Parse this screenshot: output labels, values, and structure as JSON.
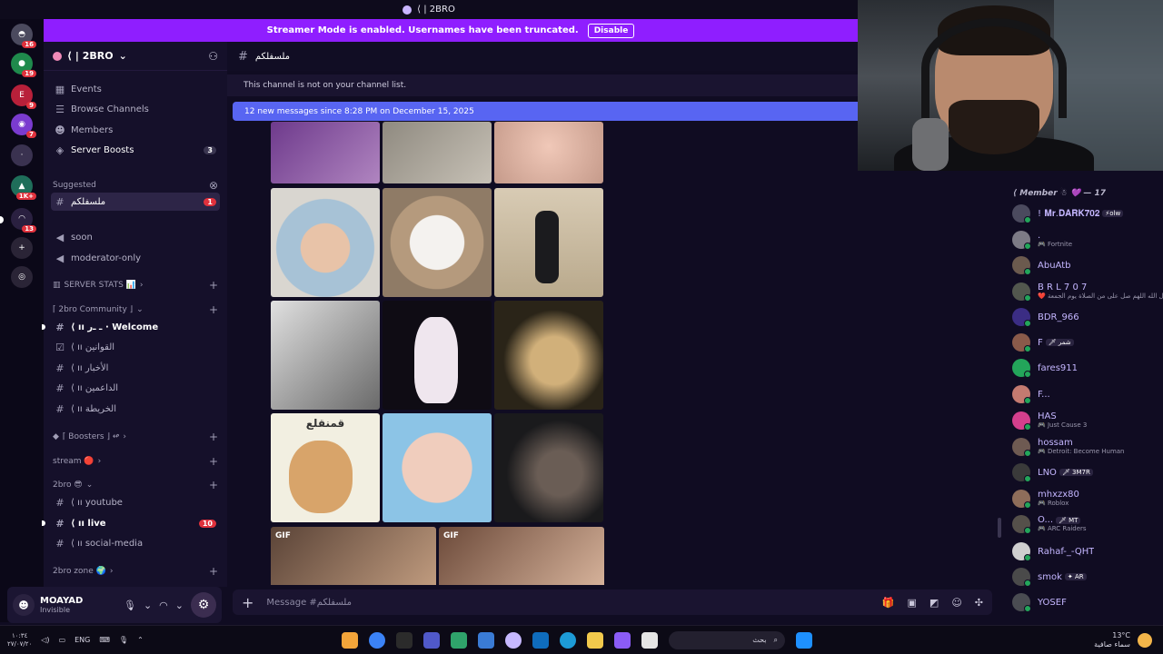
{
  "titlebar": {
    "title": "⟨ | 2BRO"
  },
  "banner": {
    "text": "Streamer Mode is enabled. Usernames have been truncated.",
    "button": "Disable"
  },
  "servers": [
    {
      "icon": "discord-icon",
      "badge": "16",
      "color": "#4b4a5e"
    },
    {
      "icon": "server-icon",
      "badge": "19",
      "color": "#1f8a4c"
    },
    {
      "icon": "server-icon",
      "badge": "9",
      "color": "#b8203a"
    },
    {
      "icon": "server-icon",
      "badge": "7",
      "color": "#7a3bcf"
    },
    {
      "icon": "server-icon",
      "badge": "",
      "color": "#3a3250"
    },
    {
      "icon": "server-icon",
      "badge": "1K+",
      "color": "#1f6e5a"
    },
    {
      "icon": "server-icon",
      "badge": "13",
      "color": "#2a2040"
    },
    {
      "icon": "add-server-icon",
      "badge": "",
      "color": "#2a2436"
    },
    {
      "icon": "explore-icon",
      "badge": "",
      "color": "#2a2436"
    }
  ],
  "guild": {
    "name": "⟨ | 2BRO"
  },
  "sidebar": {
    "top_items": [
      {
        "label": "Events",
        "icon": "calendar-icon"
      },
      {
        "label": "Browse Channels",
        "icon": "browse-icon"
      },
      {
        "label": "Members",
        "icon": "members-icon"
      },
      {
        "label": "Server Boosts",
        "icon": "boost-icon",
        "count": "3"
      }
    ],
    "suggested_label": "Suggested",
    "suggested_channel": {
      "label": "ملسفلكم",
      "count": "1"
    },
    "channels_a": [
      {
        "label": "soon",
        "icon": "megaphone-icon"
      },
      {
        "label": "moderator-only",
        "icon": "megaphone-icon"
      }
    ],
    "cat_server_stats": "SERVER STATS 📊",
    "cat_community": "⌈ 2bro Community ⌋",
    "community": [
      {
        "label": "⟨ ıı ـ ـﺭ · Welcome",
        "unread": true
      },
      {
        "label": "⟨ ıı القوانين",
        "unread": false
      },
      {
        "label": "⟨ ıı الأخبار",
        "unread": false
      },
      {
        "label": "⟨ ıı الداعمين",
        "unread": false
      },
      {
        "label": "⟨ ıı الخريطة",
        "unread": false
      }
    ],
    "cat_boosters": "⌈ Boosters ⌋ ↫",
    "cat_stream": "stream 🔴",
    "cat_2bro": "2bro 😎",
    "bro_channels": [
      {
        "label": "⟨ ıı youtube",
        "unread": false,
        "count": ""
      },
      {
        "label": "⟨ ıı live",
        "unread": true,
        "count": "10"
      },
      {
        "label": "⟨ ıı social-media",
        "unread": false,
        "count": ""
      }
    ],
    "cat_zone": "2bro zone 🌍"
  },
  "user": {
    "name": "MOAYAD",
    "status": "Invisible"
  },
  "chat": {
    "channel_name": "ملسفلكم",
    "notice": "This channel is not on your channel list.",
    "new_messages": "12 new messages since 8:28 PM on December 15, 2025",
    "gif_labels": [
      "GIF",
      "GIF"
    ],
    "composer_placeholder": "Message #ملسفلكم",
    "sticker_caption": "قمنقلع"
  },
  "members": {
    "header": "⟨ Member ☃ 💜 — 17",
    "list": [
      {
        "name": "! 𝐌𝐫.𝐃𝐀𝐑𝐊𝟕𝟎𝟐",
        "sub": "",
        "tag": "⚡olw",
        "color": "#4b4a5e"
      },
      {
        "name": ".",
        "sub": "🎮 Fortnite",
        "tag": "",
        "color": "#7d7b86"
      },
      {
        "name": "AbuAtb",
        "sub": "",
        "tag": "",
        "color": "#6b5a4e"
      },
      {
        "name": "B R L 7 0 7",
        "sub": "❤️ رسول الله اللهم صل على من الصلاة يوم الجمعة",
        "tag": "",
        "color": "#52574e"
      },
      {
        "name": "BDR_966",
        "sub": "",
        "tag": "",
        "color": "#3b2d84"
      },
      {
        "name": "F",
        "sub": "",
        "tag": "🗡 شمر",
        "color": "#8a5a4a"
      },
      {
        "name": "fares911",
        "sub": "",
        "tag": "",
        "color": "#23a55a"
      },
      {
        "name": "F...",
        "sub": "",
        "tag": "",
        "color": "#c47a70"
      },
      {
        "name": "HAS",
        "sub": "🎮 Just Cause 3",
        "tag": "",
        "color": "#d43f8d"
      },
      {
        "name": "hossam",
        "sub": "🎮 Detroit: Become Human",
        "tag": "",
        "color": "#6e5a52"
      },
      {
        "name": "LNO",
        "sub": "",
        "tag": "🗡 3M7R",
        "color": "#3a3a3a"
      },
      {
        "name": "mhxzx80",
        "sub": "🎮 Roblox",
        "tag": "",
        "color": "#8e6d5a"
      },
      {
        "name": "O...",
        "sub": "🎮 ARC Raiders",
        "tag": "🗡 MT",
        "color": "#55504a"
      },
      {
        "name": "Rahaf-_-QHT",
        "sub": "",
        "tag": "",
        "color": "#cfcfcf"
      },
      {
        "name": "smok",
        "sub": "",
        "tag": "✦ AR",
        "color": "#4a4a4a"
      },
      {
        "name": "YOSEF",
        "sub": "",
        "tag": "",
        "color": "#4a4c52"
      }
    ]
  },
  "taskbar": {
    "clock_time": "١٠:٣٤",
    "clock_date": "٢٧/٠٧/٢٠",
    "lang": "ENG",
    "search_placeholder": "بحث",
    "temperature": "13°C",
    "weather": "سماء صافية"
  },
  "colors": {
    "accent": "#5865f2",
    "banner": "#8f1eff",
    "mention": "#e0313c",
    "online": "#23a55a"
  }
}
